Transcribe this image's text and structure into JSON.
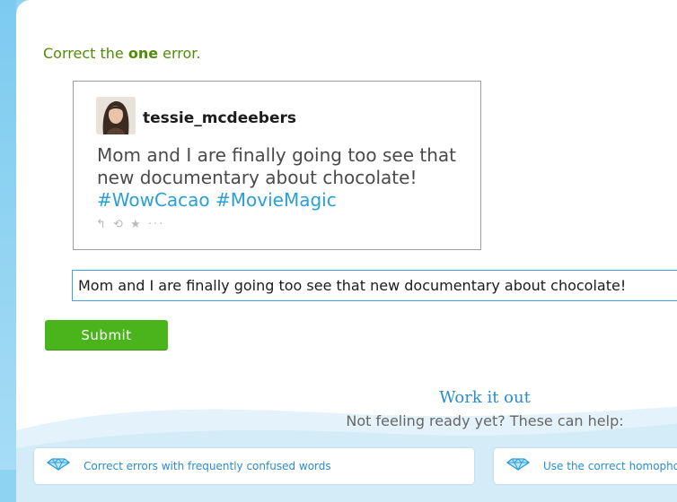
{
  "prompt": {
    "before": "Correct the ",
    "bold": "one",
    "after": " error."
  },
  "tweet": {
    "handle": "tessie_mcdeebers",
    "text": "Mom and I are finally going too see that new documentary about chocolate!",
    "hashtags": "#WowCacao #MovieMagic",
    "actions": "↰ ⟲ ★ ···"
  },
  "answer": {
    "value": "Mom and I are finally going too see that new documentary about chocolate!"
  },
  "submit_label": "Submit",
  "help": {
    "title": "Work it out",
    "subtitle": "Not feeling ready yet? These can help:",
    "skills": [
      {
        "label": "Correct errors with frequently confused words"
      },
      {
        "label": "Use the correct homophone"
      }
    ]
  },
  "colors": {
    "prompt": "#4f8d05",
    "hashtag": "#2a9fd6",
    "submit": "#49b51a",
    "heading": "#2a8dd0"
  }
}
